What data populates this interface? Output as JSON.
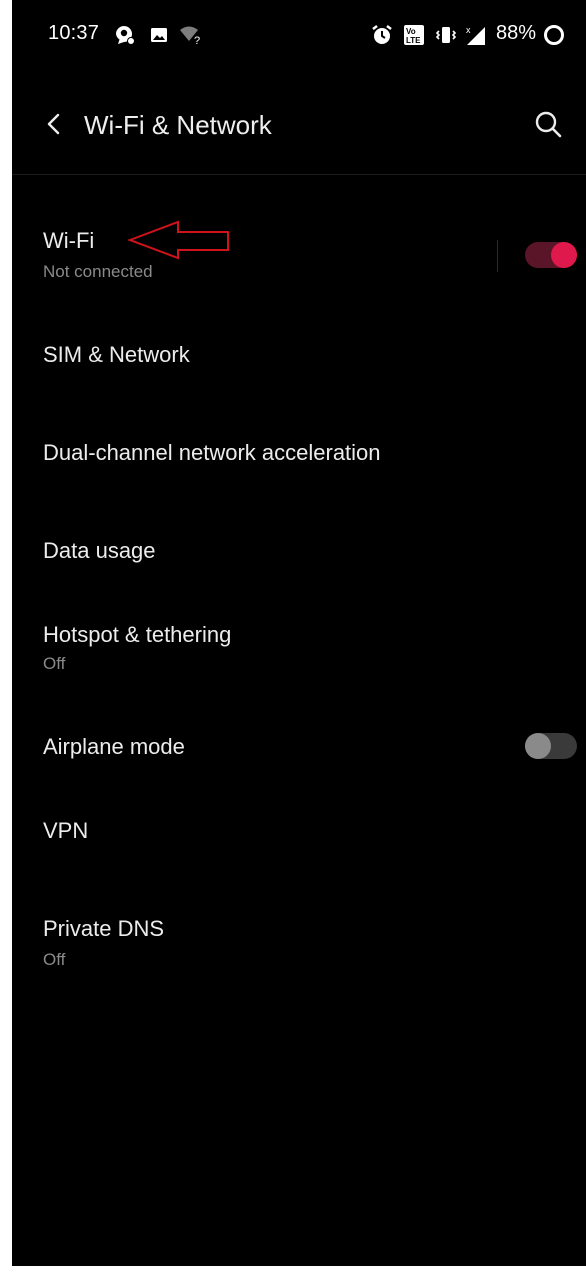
{
  "status_bar": {
    "time": "10:37",
    "battery_percent": "88%",
    "icons": [
      "chat-notification-icon",
      "image-icon",
      "wifi-unknown-icon",
      "alarm-icon",
      "volte-icon",
      "vibrate-icon",
      "signal-icon",
      "battery-ring-icon"
    ]
  },
  "header": {
    "title": "Wi-Fi & Network",
    "back_icon": "chevron-left-icon",
    "search_icon": "search-icon"
  },
  "settings": [
    {
      "title": "Wi-Fi",
      "subtitle": "Not connected",
      "toggle": true,
      "toggle_on": true
    },
    {
      "title": "SIM & Network"
    },
    {
      "title": "Dual-channel network acceleration"
    },
    {
      "title": "Data usage"
    },
    {
      "title": "Hotspot & tethering",
      "subtitle": "Off"
    },
    {
      "title": "Airplane mode",
      "toggle": true,
      "toggle_on": false
    },
    {
      "title": "VPN"
    },
    {
      "title": "Private DNS",
      "subtitle": "Off"
    }
  ],
  "colors": {
    "background": "#000000",
    "accent": "#e0194c",
    "text_primary": "#ececec",
    "text_secondary": "#8a8a8a",
    "annotation_arrow": "#d0121b"
  }
}
